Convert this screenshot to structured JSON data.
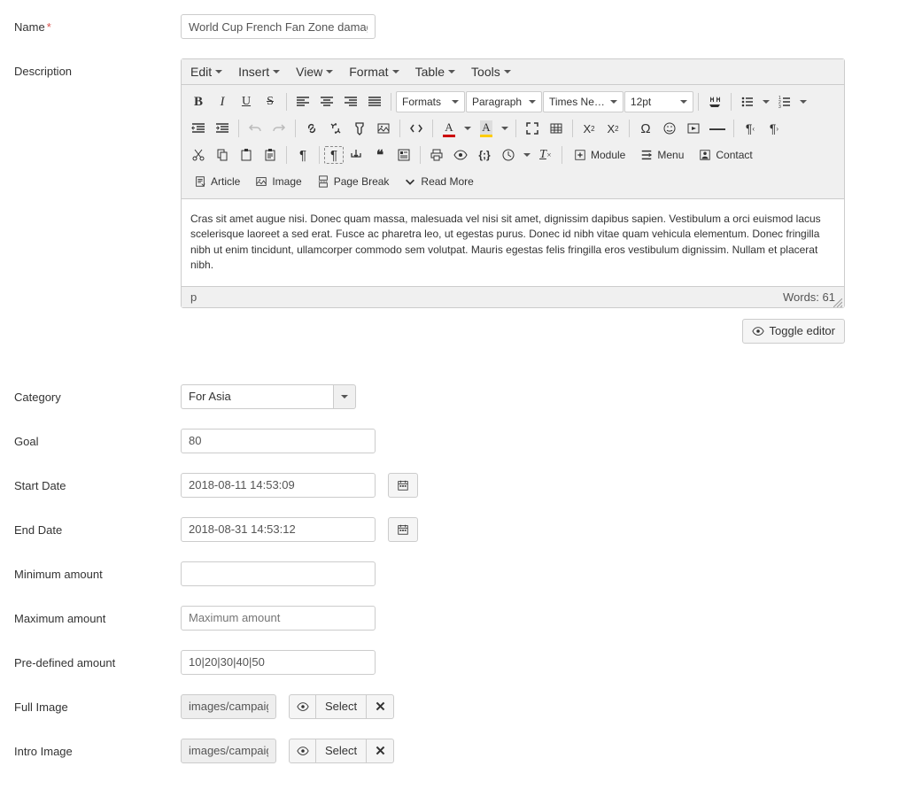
{
  "labels": {
    "name": "Name",
    "description": "Description",
    "category": "Category",
    "goal": "Goal",
    "start_date": "Start Date",
    "end_date": "End Date",
    "min_amount": "Minimum amount",
    "max_amount": "Maximum amount",
    "predefined": "Pre-defined amount",
    "full_image": "Full Image",
    "intro_image": "Intro Image"
  },
  "required_mark": "*",
  "values": {
    "name": "World Cup French Fan Zone damag",
    "category": "For Asia",
    "goal": "80",
    "start_date": "2018-08-11 14:53:09",
    "end_date": "2018-08-31 14:53:12",
    "min_amount": "",
    "max_amount": "",
    "max_amount_placeholder": "Maximum amount",
    "predefined": "10|20|30|40|50",
    "full_image": "images/campaig",
    "intro_image": "images/campaig"
  },
  "editor": {
    "menus": [
      "Edit",
      "Insert",
      "View",
      "Format",
      "Table",
      "Tools"
    ],
    "formats_label": "Formats",
    "block_label": "Paragraph",
    "font_label": "Times Ne…",
    "size_label": "12pt",
    "content": "Cras sit amet augue nisi. Donec quam massa, malesuada vel nisi sit amet, dignissim dapibus sapien. Vestibulum a orci euismod lacus scelerisque laoreet a sed erat. Fusce ac pharetra leo, ut egestas purus. Donec id nibh vitae quam vehicula elementum. Donec fringilla nibh ut enim tincidunt, ullamcorper commodo sem volutpat. Mauris egestas felis fringilla eros vestibulum dignissim. Nullam et placerat nibh.",
    "status_path": "p",
    "status_words": "Words: 61",
    "buttons": {
      "article": "Article",
      "image": "Image",
      "page_break": "Page Break",
      "read_more": "Read More",
      "module": "Module",
      "menu": "Menu",
      "contact": "Contact"
    }
  },
  "toggle_editor": "Toggle editor",
  "select_label": "Select"
}
